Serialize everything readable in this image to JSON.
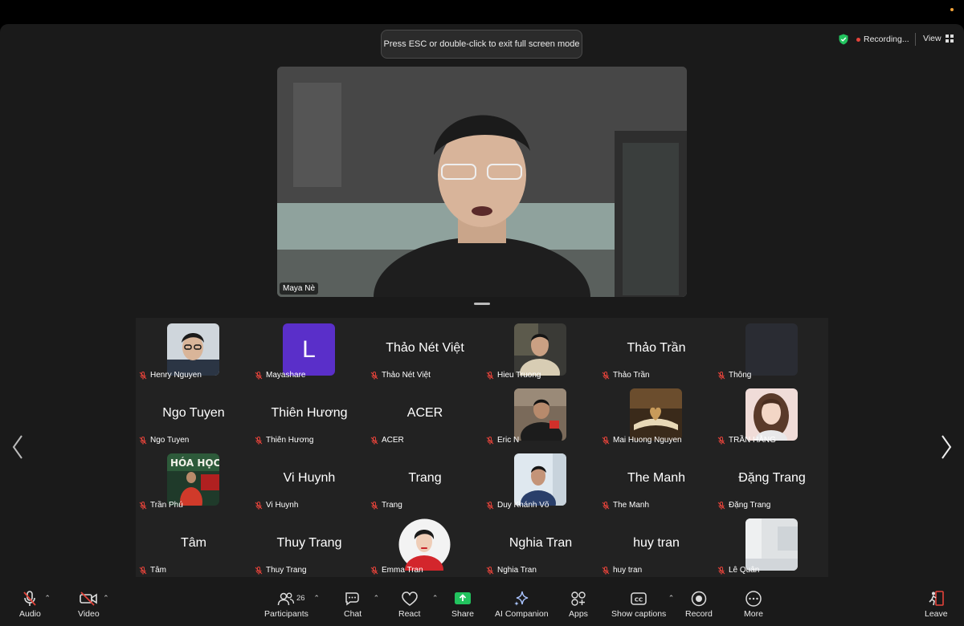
{
  "window": {
    "esc_toast": "Press ESC or double-click to exit full screen mode"
  },
  "status": {
    "recording": "Recording...",
    "view": "View"
  },
  "speaker": {
    "name": "Maya Nè"
  },
  "participants": [
    {
      "label": "Henry Nguyen",
      "big": "",
      "photo": "man-glasses"
    },
    {
      "label": "Mayashare",
      "big": "",
      "photo": "avatar-L",
      "initial": "L"
    },
    {
      "label": "Thảo Nét Việt",
      "big": "Thảo Nét Việt",
      "photo": ""
    },
    {
      "label": "Hieu Truong",
      "big": "",
      "photo": "man-beige"
    },
    {
      "label": "Thảo Trần",
      "big": "Thảo Trần",
      "photo": ""
    },
    {
      "label": "Thông",
      "big": "",
      "photo": "dark"
    },
    {
      "label": "Ngo Tuyen",
      "big": "Ngo Tuyen",
      "photo": ""
    },
    {
      "label": "Thiên Hương",
      "big": "Thiên Hương",
      "photo": ""
    },
    {
      "label": "ACER",
      "big": "ACER",
      "photo": ""
    },
    {
      "label": "Eric N",
      "big": "",
      "photo": "man-desk"
    },
    {
      "label": "Mai Huong Nguyen",
      "big": "",
      "photo": "book-heart"
    },
    {
      "label": "TRẦN HẰNG",
      "big": "",
      "photo": "woman"
    },
    {
      "label": "Trần Phú",
      "big": "",
      "photo": "presenter"
    },
    {
      "label": "Vi Huynh",
      "big": "Vi Huynh",
      "photo": ""
    },
    {
      "label": "Trang",
      "big": "Trang",
      "photo": ""
    },
    {
      "label": "Duy Khánh Võ",
      "big": "",
      "photo": "man-phone"
    },
    {
      "label": "The Manh",
      "big": "The Manh",
      "photo": ""
    },
    {
      "label": "Đặng Trang",
      "big": "Đặng Trang",
      "photo": ""
    },
    {
      "label": "Tâm",
      "big": "Tâm",
      "photo": ""
    },
    {
      "label": "Thuy Trang",
      "big": "Thuy Trang",
      "photo": ""
    },
    {
      "label": "Emma Tran",
      "big": "",
      "photo": "woman-red"
    },
    {
      "label": "Nghia Tran",
      "big": "Nghia Tran",
      "photo": ""
    },
    {
      "label": "huy tran",
      "big": "huy tran",
      "photo": ""
    },
    {
      "label": "Lê Quân",
      "big": "",
      "photo": "room"
    }
  ],
  "toolbar": {
    "audio": "Audio",
    "video": "Video",
    "participants": "Participants",
    "participants_count": "26",
    "chat": "Chat",
    "react": "React",
    "share": "Share",
    "ai_companion": "AI Companion",
    "apps": "Apps",
    "captions": "Show captions",
    "record": "Record",
    "more": "More",
    "leave": "Leave"
  },
  "colors": {
    "share_green": "#22c35e",
    "leave_red": "#e4433a",
    "mic_off_red": "#e4433a",
    "avatar_purple": "#5a2fc9"
  }
}
